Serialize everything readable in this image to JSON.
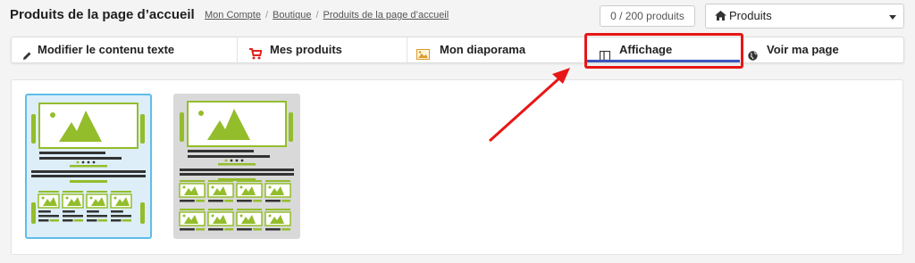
{
  "header": {
    "title": "Produits de la page d’accueil",
    "breadcrumb": [
      "Mon Compte",
      "Boutique",
      "Produits de la page d’accueil"
    ],
    "counter": "0 / 200 produits",
    "select_value": "Produits"
  },
  "tabs": [
    {
      "label": "Modifier le contenu texte",
      "icon": "pencil-icon",
      "active": false
    },
    {
      "label": "Mes produits",
      "icon": "cart-icon",
      "active": false
    },
    {
      "label": "Mon diaporama",
      "icon": "image-icon",
      "active": false
    },
    {
      "label": "Affichage",
      "icon": "columns-icon",
      "active": true
    },
    {
      "label": "Voir ma page",
      "icon": "globe-icon",
      "active": false
    }
  ],
  "layouts": [
    {
      "name": "layout-option-1",
      "selected": true,
      "product_columns": 4,
      "product_rows": 1
    },
    {
      "name": "layout-option-2",
      "selected": false,
      "product_columns": 4,
      "product_rows": 2
    }
  ],
  "colors": {
    "accent_green": "#94bd2c",
    "tab_active": "#3a56c0",
    "highlight_red": "#e81616",
    "selected_border": "#5fbde9"
  }
}
